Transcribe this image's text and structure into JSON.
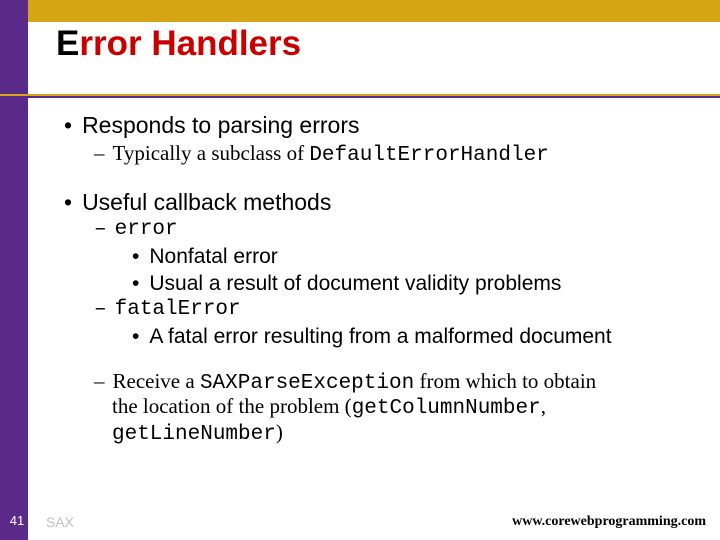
{
  "title": {
    "first": "E",
    "rest": "rror Handlers"
  },
  "b1": "Responds to parsing errors",
  "b1a_pre": "Typically a subclass of ",
  "b1a_code": "DefaultErrorHandler",
  "b2": "Useful callback methods",
  "b2a": "error",
  "b2a1": "Nonfatal error",
  "b2a2": "Usual a result of document validity problems",
  "b2b": "fatalError",
  "b2b1": "A fatal error resulting from a malformed document",
  "b2c_t1": "Receive a ",
  "b2c_c1": "SAXParseException",
  "b2c_t2": " from which to obtain ",
  "b2c_t3": "the location of the problem (",
  "b2c_c2": "getColumnNumber",
  "b2c_t4": ", ",
  "b2c_c3": "getLineNumber",
  "b2c_t5": ")",
  "footer": {
    "num": "41",
    "label": "SAX",
    "url": "www.corewebprogramming.com"
  }
}
